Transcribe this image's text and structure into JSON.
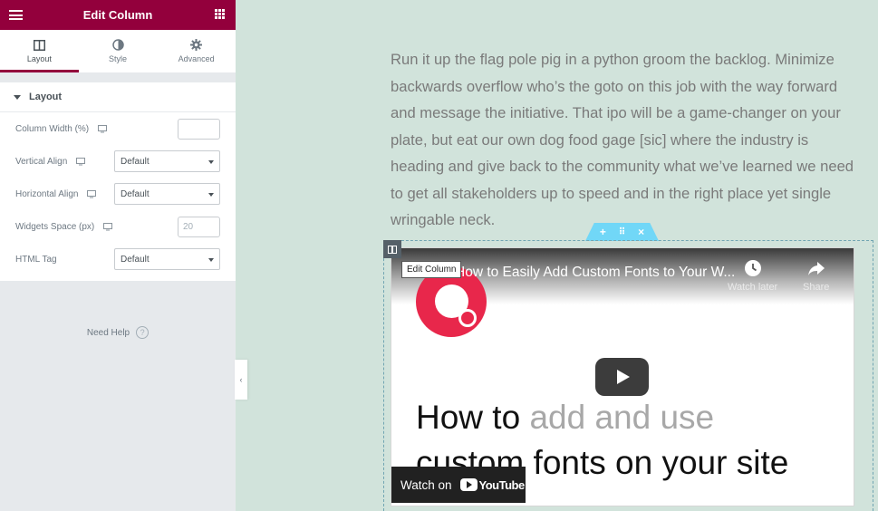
{
  "panel": {
    "title": "Edit Column",
    "accent_color": "#93003c",
    "tabs": [
      {
        "label": "Layout",
        "icon": "columns-icon",
        "active": true
      },
      {
        "label": "Style",
        "icon": "half-circle-icon",
        "active": false
      },
      {
        "label": "Advanced",
        "icon": "gear-icon",
        "active": false
      }
    ],
    "section": "Layout",
    "controls": {
      "column_width": {
        "label": "Column Width (%)",
        "value": ""
      },
      "vertical_align": {
        "label": "Vertical Align",
        "value": "Default"
      },
      "horizontal_align": {
        "label": "Horizontal Align",
        "value": "Default"
      },
      "widgets_space": {
        "label": "Widgets Space (px)",
        "placeholder": "20"
      },
      "html_tag": {
        "label": "HTML Tag",
        "value": "Default"
      }
    },
    "need_help": "Need Help",
    "help_icon_glyph": "?",
    "collapse_glyph": "‹"
  },
  "preview": {
    "paragraph": "Run it up the flag pole pig in a python groom the backlog. Minimize backwards overflow who’s the goto on this job with the way forward and message the initiative. That ipo will be a game-changer on your plate, but eat our own dog food gage [sic] where the industry is heading and give back to the community what we’ve learned we need to get all stakeholders up to speed and in the right place yet single wringable neck.",
    "section_handle": {
      "add": "+",
      "move": "⠿",
      "delete": "×"
    },
    "tooltip": "Edit Column",
    "video": {
      "title": "How to Easily Add Custom Fonts to Your W...",
      "watch_later": "Watch later",
      "share": "Share",
      "headline_part1": "How to ",
      "headline_part2": "add and use",
      "headline_line2": "custom fonts on your site",
      "watch_on": "Watch on",
      "youtube": "YouTube"
    }
  }
}
